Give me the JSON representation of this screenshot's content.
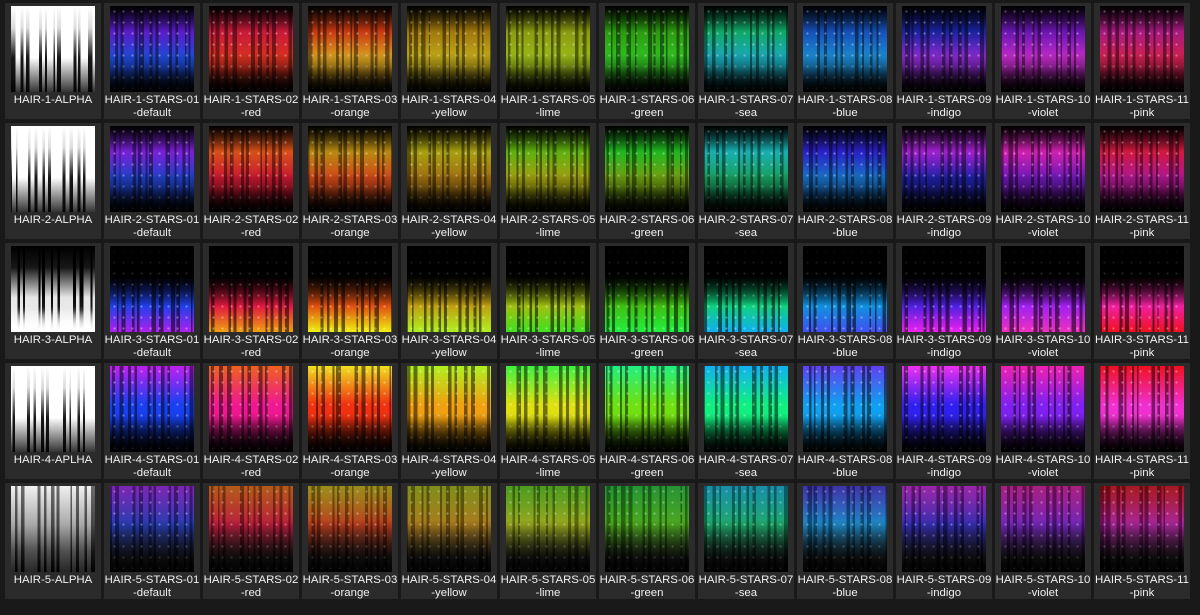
{
  "rows": [
    {
      "alpha": "HAIR-1-ALPHA",
      "style": "top",
      "items": [
        {
          "line1": "HAIR-1-STARS-01",
          "line2": "-default",
          "c1": "#5a1cc8",
          "c2": "#1f4ad8"
        },
        {
          "line1": "HAIR-1-STARS-02",
          "line2": "-red",
          "c1": "#c81a3a",
          "c2": "#d83020"
        },
        {
          "line1": "HAIR-1-STARS-03",
          "line2": "-orange",
          "c1": "#c83a12",
          "c2": "#d8a020"
        },
        {
          "line1": "HAIR-1-STARS-04",
          "line2": "-yellow",
          "c1": "#a0780c",
          "c2": "#c0a818"
        },
        {
          "line1": "HAIR-1-STARS-05",
          "line2": "-lime",
          "c1": "#8a9a10",
          "c2": "#9ab818"
        },
        {
          "line1": "HAIR-1-STARS-06",
          "line2": "-green",
          "c1": "#2c9a10",
          "c2": "#30c020"
        },
        {
          "line1": "HAIR-1-STARS-07",
          "line2": "-sea",
          "c1": "#10a868",
          "c2": "#1aa8b8"
        },
        {
          "line1": "HAIR-1-STARS-08",
          "line2": "-blue",
          "c1": "#1650b8",
          "c2": "#1c8ad0"
        },
        {
          "line1": "HAIR-1-STARS-09",
          "line2": "-indigo",
          "c1": "#1a22a0",
          "c2": "#8a2ad0"
        },
        {
          "line1": "HAIR-1-STARS-10",
          "line2": "-violet",
          "c1": "#6a16b0",
          "c2": "#c02ac8"
        },
        {
          "line1": "HAIR-1-STARS-11",
          "line2": "-pink",
          "c1": "#a81a80",
          "c2": "#d02050"
        }
      ]
    },
    {
      "alpha": "HAIR-2-ALPHA",
      "style": "top",
      "items": [
        {
          "line1": "HAIR-2-STARS-01",
          "line2": "-default",
          "c1": "#7a20d8",
          "c2": "#2040c8"
        },
        {
          "line1": "HAIR-2-STARS-02",
          "line2": "-red",
          "c1": "#d85018",
          "c2": "#c81830"
        },
        {
          "line1": "HAIR-2-STARS-03",
          "line2": "-orange",
          "c1": "#b88a10",
          "c2": "#d04818"
        },
        {
          "line1": "HAIR-2-STARS-04",
          "line2": "-yellow",
          "c1": "#a8a010",
          "c2": "#a07010"
        },
        {
          "line1": "HAIR-2-STARS-05",
          "line2": "-lime",
          "c1": "#60b010",
          "c2": "#a0a010"
        },
        {
          "line1": "HAIR-2-STARS-06",
          "line2": "-green",
          "c1": "#20b820",
          "c2": "#70a010"
        },
        {
          "line1": "HAIR-2-STARS-07",
          "line2": "-sea",
          "c1": "#18b0b0",
          "c2": "#18a060"
        },
        {
          "line1": "HAIR-2-STARS-08",
          "line2": "-blue",
          "c1": "#2a20c8",
          "c2": "#1870c8"
        },
        {
          "line1": "HAIR-2-STARS-09",
          "line2": "-indigo",
          "c1": "#a020d0",
          "c2": "#2020a8"
        },
        {
          "line1": "HAIR-2-STARS-10",
          "line2": "-violet",
          "c1": "#d020b0",
          "c2": "#7018b8"
        },
        {
          "line1": "HAIR-2-STARS-11",
          "line2": "-pink",
          "c1": "#d01840",
          "c2": "#b01890"
        }
      ]
    },
    {
      "alpha": "HAIR-3-ALPHA",
      "style": "bottom",
      "items": [
        {
          "line1": "HAIR-3-STARS-01",
          "line2": "-default",
          "c1": "#2040e8",
          "c2": "#b020f0"
        },
        {
          "line1": "HAIR-3-STARS-02",
          "line2": "-red",
          "c1": "#e01840",
          "c2": "#f0a010"
        },
        {
          "line1": "HAIR-3-STARS-03",
          "line2": "-orange",
          "c1": "#e05010",
          "c2": "#f0f010"
        },
        {
          "line1": "HAIR-3-STARS-04",
          "line2": "-yellow",
          "c1": "#c0a010",
          "c2": "#b0f020"
        },
        {
          "line1": "HAIR-3-STARS-05",
          "line2": "-lime",
          "c1": "#a0c010",
          "c2": "#40e020"
        },
        {
          "line1": "HAIR-3-STARS-06",
          "line2": "-green",
          "c1": "#40c010",
          "c2": "#20f040"
        },
        {
          "line1": "HAIR-3-STARS-07",
          "line2": "-sea",
          "c1": "#10d080",
          "c2": "#10b0f0"
        },
        {
          "line1": "HAIR-3-STARS-08",
          "line2": "-blue",
          "c1": "#1090e0",
          "c2": "#4050f0"
        },
        {
          "line1": "HAIR-3-STARS-09",
          "line2": "-indigo",
          "c1": "#5020e0",
          "c2": "#f020f0"
        },
        {
          "line1": "HAIR-3-STARS-10",
          "line2": "-violet",
          "c1": "#a020f0",
          "c2": "#f030c0"
        },
        {
          "line1": "HAIR-3-STARS-11",
          "line2": "-pink",
          "c1": "#f020a0",
          "c2": "#f01020"
        }
      ]
    },
    {
      "alpha": "HAIR-4-APLHA",
      "style": "bright",
      "items": [
        {
          "line1": "HAIR-4-STARS-01",
          "line2": "-default",
          "c1": "#c020f0",
          "c2": "#1840f0"
        },
        {
          "line1": "HAIR-4-STARS-02",
          "line2": "-red",
          "c1": "#f06020",
          "c2": "#f01890"
        },
        {
          "line1": "HAIR-4-STARS-03",
          "line2": "-orange",
          "c1": "#f0e020",
          "c2": "#f03010"
        },
        {
          "line1": "HAIR-4-STARS-04",
          "line2": "-yellow",
          "c1": "#b0f020",
          "c2": "#f0a010"
        },
        {
          "line1": "HAIR-4-STARS-05",
          "line2": "-lime",
          "c1": "#40f040",
          "c2": "#e0e010"
        },
        {
          "line1": "HAIR-4-STARS-06",
          "line2": "-green",
          "c1": "#20f080",
          "c2": "#70e010"
        },
        {
          "line1": "HAIR-4-STARS-07",
          "line2": "-sea",
          "c1": "#10b0f0",
          "c2": "#10f080"
        },
        {
          "line1": "HAIR-4-STARS-08",
          "line2": "-blue",
          "c1": "#6040f0",
          "c2": "#10a0f0"
        },
        {
          "line1": "HAIR-4-STARS-09",
          "line2": "-indigo",
          "c1": "#f030f0",
          "c2": "#3020f0"
        },
        {
          "line1": "HAIR-4-STARS-10",
          "line2": "-violet",
          "c1": "#f020b0",
          "c2": "#8020f0"
        },
        {
          "line1": "HAIR-4-STARS-11",
          "line2": "-pink",
          "c1": "#f01020",
          "c2": "#f030d0"
        }
      ]
    },
    {
      "alpha": "HAIR-5-ALPHA",
      "style": "lines",
      "items": [
        {
          "line1": "HAIR-5-STARS-01",
          "line2": "-default",
          "c1": "#8a20d0",
          "c2": "#1a30a8"
        },
        {
          "line1": "HAIR-5-STARS-02",
          "line2": "-red",
          "c1": "#d06010",
          "c2": "#b01030"
        },
        {
          "line1": "HAIR-5-STARS-03",
          "line2": "-orange",
          "c1": "#b0a010",
          "c2": "#b03010"
        },
        {
          "line1": "HAIR-5-STARS-04",
          "line2": "-yellow",
          "c1": "#90a010",
          "c2": "#a07010"
        },
        {
          "line1": "HAIR-5-STARS-05",
          "line2": "-lime",
          "c1": "#50b018",
          "c2": "#90a010"
        },
        {
          "line1": "HAIR-5-STARS-06",
          "line2": "-green",
          "c1": "#20a830",
          "c2": "#40a010"
        },
        {
          "line1": "HAIR-5-STARS-07",
          "line2": "-sea",
          "c1": "#10a0c0",
          "c2": "#10a060"
        },
        {
          "line1": "HAIR-5-STARS-08",
          "line2": "-blue",
          "c1": "#4030c0",
          "c2": "#1080c0"
        },
        {
          "line1": "HAIR-5-STARS-09",
          "line2": "-indigo",
          "c1": "#b020c0",
          "c2": "#2820a8"
        },
        {
          "line1": "HAIR-5-STARS-10",
          "line2": "-violet",
          "c1": "#c01890",
          "c2": "#6818b0"
        },
        {
          "line1": "HAIR-5-STARS-11",
          "line2": "-pink",
          "c1": "#c01018",
          "c2": "#a01890"
        }
      ]
    }
  ]
}
